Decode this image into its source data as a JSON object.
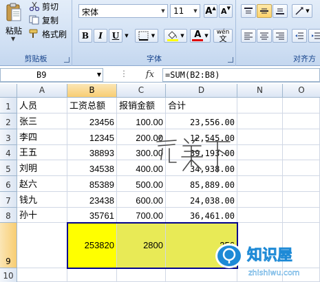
{
  "ribbon": {
    "clipboard": {
      "paste_label": "粘贴",
      "cut_label": "剪切",
      "copy_label": "复制",
      "format_painter_label": "格式刷",
      "group_label": "剪贴板"
    },
    "font": {
      "font_name": "宋体",
      "font_size": "11",
      "bold": "B",
      "italic": "I",
      "underline": "U",
      "grow": "A",
      "shrink": "A",
      "font_color_letter": "A",
      "phonetic": "wén",
      "group_label": "字体"
    },
    "alignment": {
      "group_label": "对齐方"
    }
  },
  "formula_bar": {
    "name_box": "B9",
    "fx": "fx",
    "formula": "=SUM(B2:B8)"
  },
  "sheet": {
    "columns": [
      "A",
      "B",
      "C",
      "D",
      "N",
      "O"
    ],
    "selected_column": "B",
    "selected_row": "9",
    "row_numbers": [
      "1",
      "2",
      "3",
      "4",
      "5",
      "6",
      "7",
      "8",
      "9",
      "10"
    ],
    "headers": [
      "人员",
      "工资总额",
      "报销金额",
      "合计"
    ],
    "rows": [
      {
        "name": "张三",
        "salary": "23456",
        "reimb": "100.00",
        "total": "23,556.00"
      },
      {
        "name": "李四",
        "salary": "12345",
        "reimb": "200.00",
        "total": "12,545.00"
      },
      {
        "name": "王五",
        "salary": "38893",
        "reimb": "300.00",
        "total": "39,193.00"
      },
      {
        "name": "刘明",
        "salary": "34538",
        "reimb": "400.00",
        "total": "34,938.00"
      },
      {
        "name": "赵六",
        "salary": "85389",
        "reimb": "500.00",
        "total": "85,889.00"
      },
      {
        "name": "钱九",
        "salary": "23438",
        "reimb": "600.00",
        "total": "24,038.00"
      },
      {
        "name": "孙十",
        "salary": "35761",
        "reimb": "700.00",
        "total": "36,461.00"
      }
    ],
    "sums": {
      "salary": "253820",
      "reimb": "2800",
      "total": "256"
    }
  },
  "overlays": {
    "handwriting_text": "完美下",
    "watermark_title": "知识屋",
    "watermark_url": "zhishiwu.com"
  },
  "colors": {
    "selection_border": "#00008b",
    "sum_fill_b": "#ffff00",
    "sum_fill_cd": "#e8ea56",
    "watermark_blue": "#1e8ad6"
  }
}
